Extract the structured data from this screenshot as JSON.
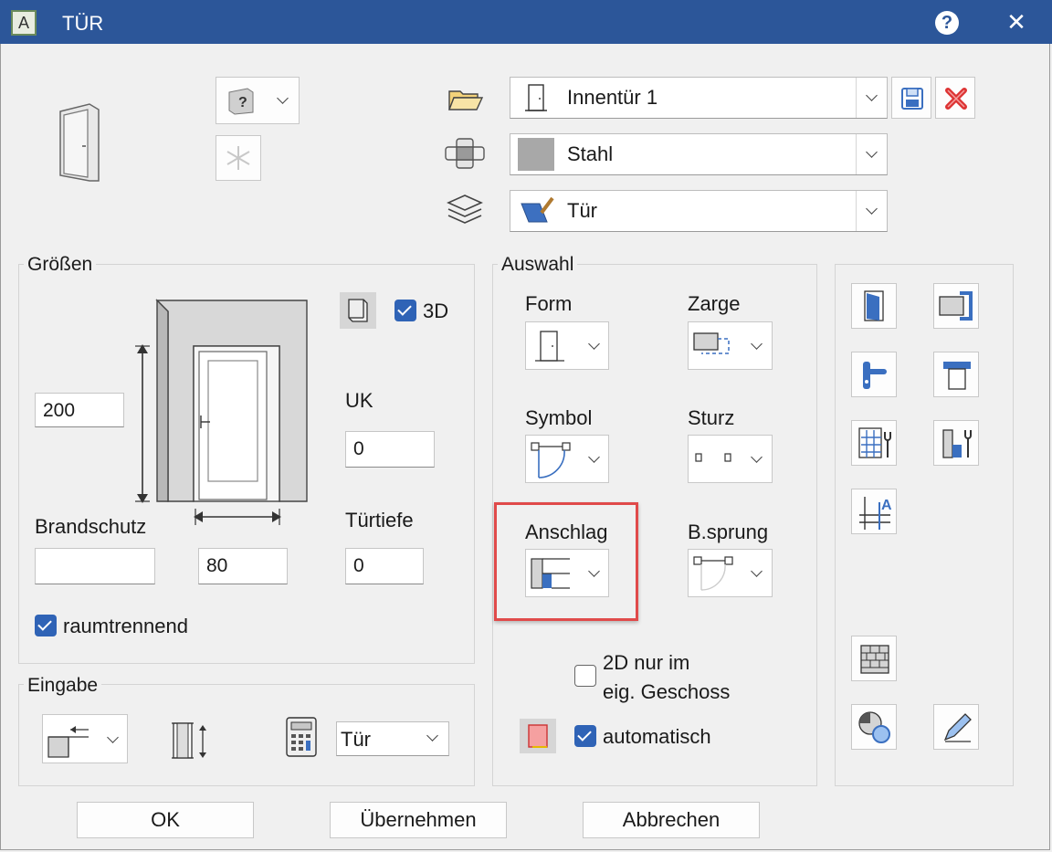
{
  "window": {
    "title": "TÜR",
    "help": "?",
    "close": "✕",
    "app_icon_letter": "A"
  },
  "top": {
    "type_combo": "Innentür 1",
    "material_combo": "Stahl",
    "layer_combo": "Tür",
    "preset_icon": "?"
  },
  "groessen": {
    "label": "Größen",
    "height_value": "200",
    "width_value": "80",
    "brandschutz_label": "Brandschutz",
    "brandschutz_value": "",
    "uk_label": "UK",
    "uk_value": "0",
    "tuertiefe_label": "Türtiefe",
    "tuertiefe_value": "0",
    "check_3d_label": "3D",
    "check_3d": true,
    "raumtrennend_label": "raumtrennend",
    "raumtrennend": true
  },
  "eingabe": {
    "label": "Eingabe",
    "combo_value": "Tür"
  },
  "auswahl": {
    "label": "Auswahl",
    "form_label": "Form",
    "zarge_label": "Zarge",
    "symbol_label": "Symbol",
    "sturz_label": "Sturz",
    "anschlag_label": "Anschlag",
    "bsprung_label": "B.sprung",
    "check_2d_label_line1": "2D nur im",
    "check_2d_label_line2": "eig. Geschoss",
    "check_2d": false,
    "automatisch_label": "automatisch",
    "automatisch": true
  },
  "footer": {
    "ok": "OK",
    "apply": "Übernehmen",
    "cancel": "Abbrechen"
  },
  "colors": {
    "titlebar": "#2c5699",
    "accent": "#2f63b6",
    "highlight": "#e04a4a"
  }
}
